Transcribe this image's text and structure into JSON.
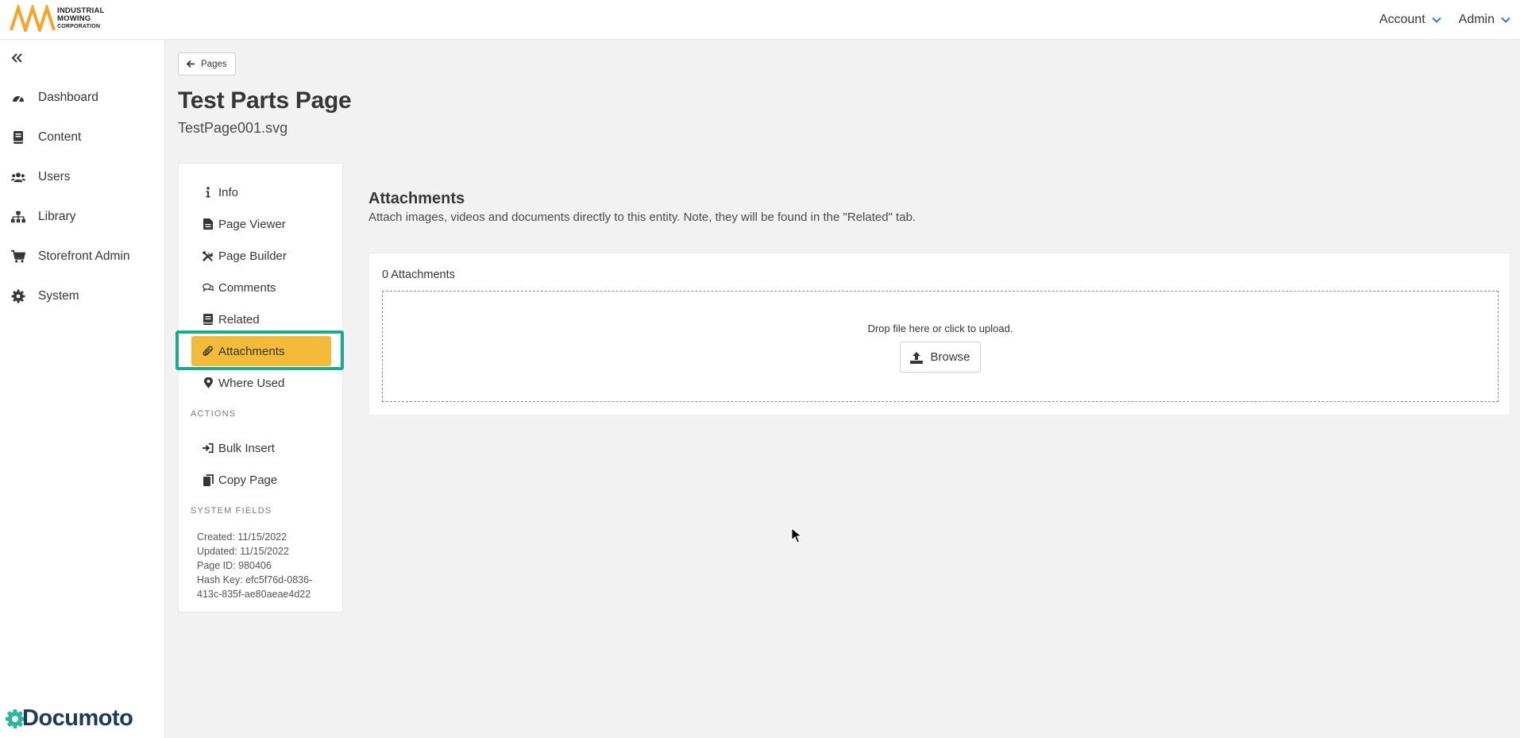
{
  "header": {
    "logo": {
      "line1": "INDUSTRIAL",
      "line2": "MOWING",
      "line3": "CORPORATION",
      "accent": "#f4a52b"
    },
    "menus": [
      {
        "label": "Account",
        "icon": "chevron-down-icon"
      },
      {
        "label": "Admin",
        "icon": "chevron-down-icon"
      }
    ],
    "chevron_color": "#2a7bd8"
  },
  "sidebar": {
    "collapse_icon": "double-chevron-left-icon",
    "items": [
      {
        "label": "Dashboard",
        "icon": "tachometer-icon"
      },
      {
        "label": "Content",
        "icon": "book-icon"
      },
      {
        "label": "Users",
        "icon": "users-icon"
      },
      {
        "label": "Library",
        "icon": "sitemap-icon"
      },
      {
        "label": "Storefront Admin",
        "icon": "cart-icon"
      },
      {
        "label": "System",
        "icon": "gear-icon"
      }
    ],
    "brand": {
      "name": "Documoto",
      "color": "#1d3a5c",
      "gear_color": "#2bb59a"
    }
  },
  "page": {
    "back_label": "Pages",
    "title": "Test Parts Page",
    "subtitle": "TestPage001.svg"
  },
  "subnav": {
    "items": [
      {
        "label": "Info",
        "icon": "info-icon"
      },
      {
        "label": "Page Viewer",
        "icon": "file-icon"
      },
      {
        "label": "Page Builder",
        "icon": "tools-icon"
      },
      {
        "label": "Comments",
        "icon": "comments-icon"
      },
      {
        "label": "Related",
        "icon": "book-icon"
      },
      {
        "label": "Attachments",
        "icon": "paperclip-icon",
        "active": true
      },
      {
        "label": "Where Used",
        "icon": "map-marker-icon"
      }
    ],
    "actions_label": "ACTIONS",
    "actions": [
      {
        "label": "Bulk Insert",
        "icon": "sign-in-icon"
      },
      {
        "label": "Copy Page",
        "icon": "copy-icon"
      }
    ],
    "system_label": "SYSTEM FIELDS",
    "system_fields": {
      "created": "Created: 11/15/2022",
      "updated": "Updated: 11/15/2022",
      "page_id": "Page ID: 980406",
      "hash_line1": "Hash Key: efc5f76d-0836-",
      "hash_line2": "413c-835f-ae80aeae4d22"
    },
    "active_color": "#f4bb3b",
    "highlight_color": "#1aaa8f"
  },
  "attachments": {
    "title": "Attachments",
    "description": "Attach images, videos and documents directly to this entity. Note, they will be found in the \"Related\" tab.",
    "count_label": "0 Attachments",
    "drop_text": "Drop file here or click to upload.",
    "browse_label": "Browse",
    "browse_icon": "upload-icon"
  }
}
